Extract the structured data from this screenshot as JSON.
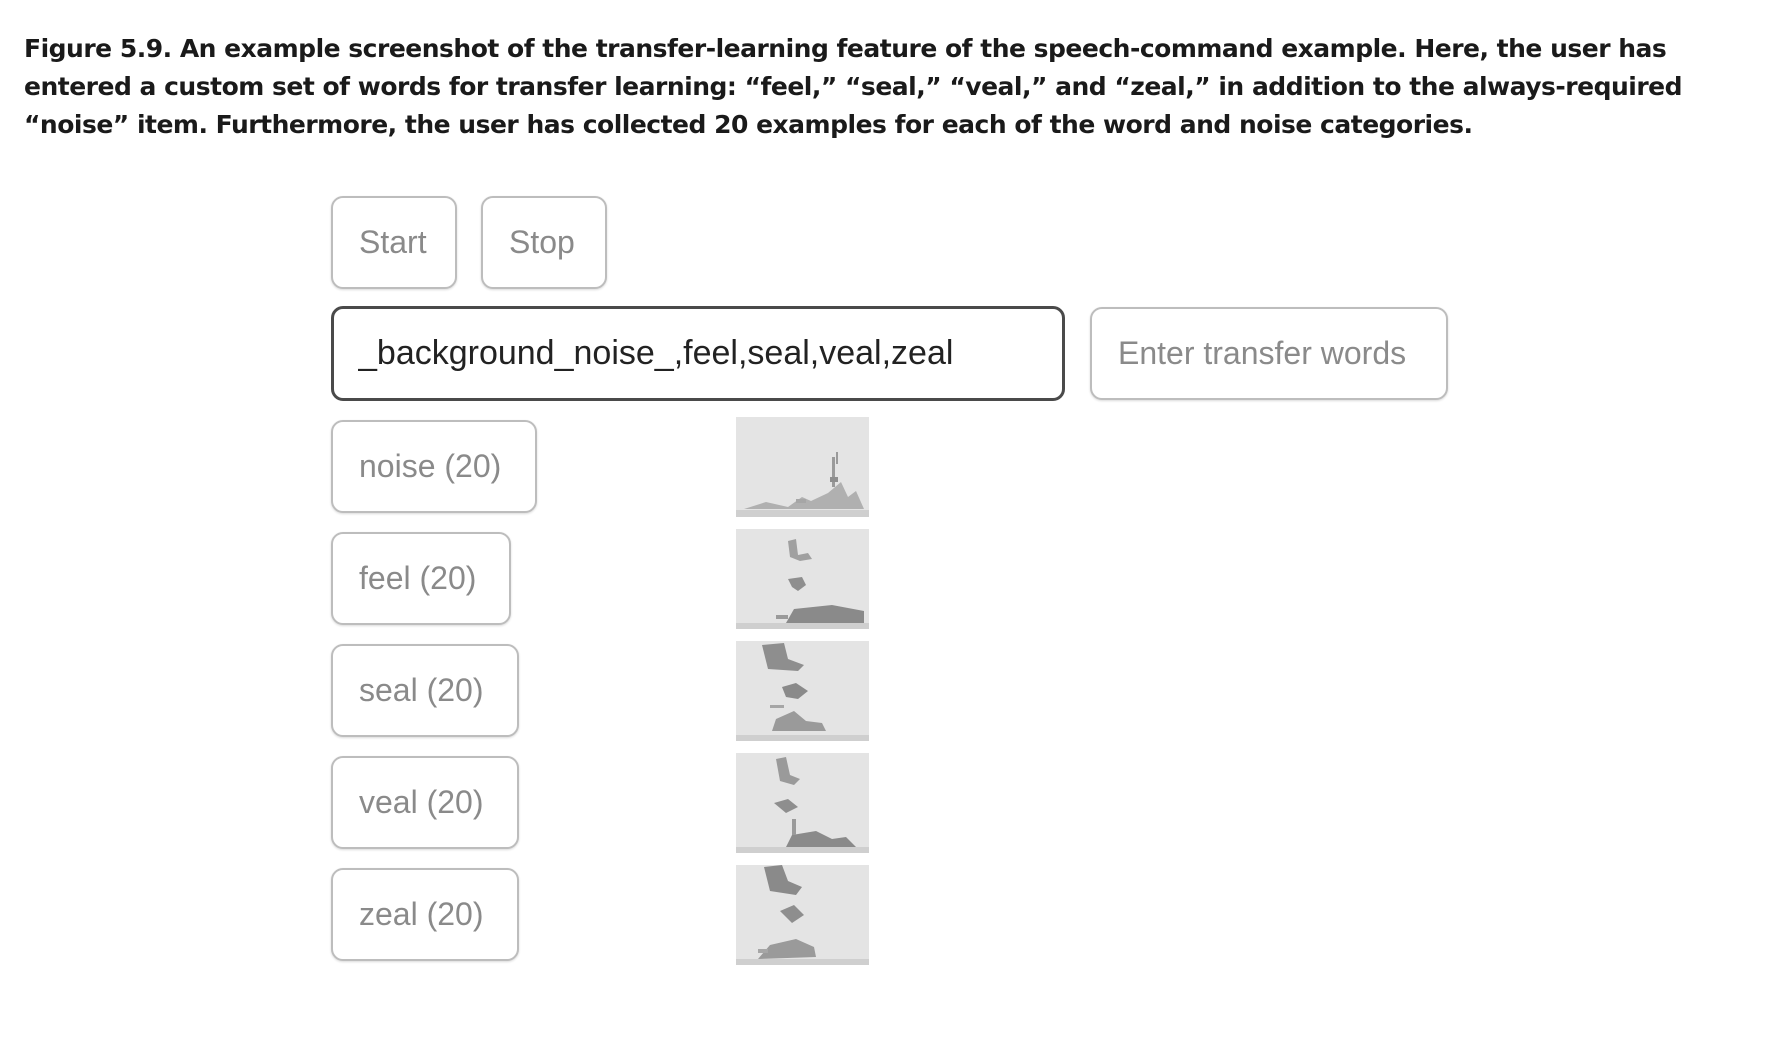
{
  "caption": "Figure 5.9. An example screenshot of the transfer-learning feature of the speech-command example. Here, the user has entered a custom set of words for transfer learning: “feel,” “seal,” “veal,” and “zeal,” in addition to the always-required “noise” item. Furthermore, the user has collected 20 examples for each of the word and noise categories.",
  "controls": {
    "start_label": "Start",
    "stop_label": "Stop"
  },
  "transfer_words": {
    "value": "_background_noise_,feel,seal,veal,zeal",
    "enter_button_label": "Enter transfer words"
  },
  "word_buttons": [
    {
      "label": "noise (20)"
    },
    {
      "label": "feel (20)"
    },
    {
      "label": "seal (20)"
    },
    {
      "label": "veal (20)"
    },
    {
      "label": "zeal (20)"
    }
  ],
  "colors": {
    "border": "#bdbdbd",
    "active_border": "#4a4a4a",
    "button_text": "#8a8a8a",
    "spectrogram_bg": "#e4e4e4",
    "spectrogram_ink": "#9a9a9a"
  }
}
